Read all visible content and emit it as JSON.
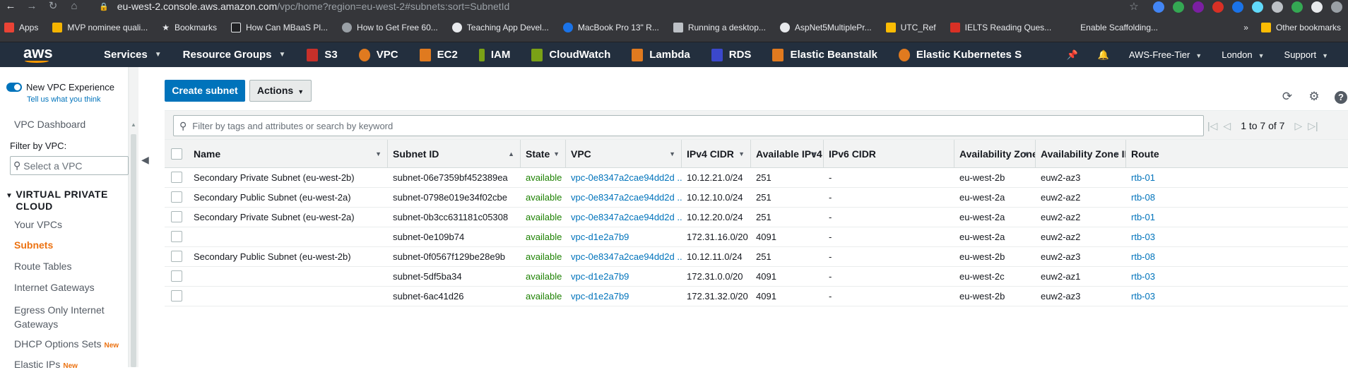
{
  "browser": {
    "url_prefix": "eu-west-2.console.aws.amazon.com",
    "url_path": "/vpc/home?region=eu-west-2#subnets:sort=SubnetId",
    "bookmarks": [
      {
        "label": "Apps",
        "color": "#ea4335"
      },
      {
        "label": "MVP nominee quali...",
        "color": "#f4b400"
      },
      {
        "label": "Bookmarks",
        "color": "#e8eaed"
      },
      {
        "label": "How Can MBaaS Pl...",
        "color": "#202124"
      },
      {
        "label": "How to Get Free 60...",
        "color": "#9aa0a6"
      },
      {
        "label": "Teaching App Devel...",
        "color": "#e8eaed"
      },
      {
        "label": "MacBook Pro 13\" R...",
        "color": "#1a73e8"
      },
      {
        "label": "Running a desktop...",
        "color": "#bdc1c6"
      },
      {
        "label": "AspNet5MultiplePr...",
        "color": "#e8eaed"
      },
      {
        "label": "UTC_Ref",
        "color": "#fbbc04"
      },
      {
        "label": "IELTS Reading Ques...",
        "color": "#d93025"
      },
      {
        "label": "Enable Scaffolding...",
        "color": "#35363a"
      }
    ],
    "other_bookmarks": "Other bookmarks",
    "more": "»"
  },
  "header": {
    "logo": "aws",
    "services": "Services",
    "resource_groups": "Resource Groups",
    "shortcuts": [
      {
        "label": "S3",
        "color": "#c7302a"
      },
      {
        "label": "VPC",
        "color": "#e07a1f"
      },
      {
        "label": "EC2",
        "color": "#e07a1f"
      },
      {
        "label": "IAM",
        "color": "#7aa116"
      },
      {
        "label": "CloudWatch",
        "color": "#7aa116"
      },
      {
        "label": "Lambda",
        "color": "#e07a1f"
      },
      {
        "label": "RDS",
        "color": "#3b48cc"
      },
      {
        "label": "Elastic Beanstalk",
        "color": "#e07a1f"
      },
      {
        "label": "Elastic Kubernetes S",
        "color": "#e07a1f"
      }
    ],
    "account": "AWS-Free-Tier",
    "region": "London",
    "support": "Support"
  },
  "sidebar": {
    "new_experience": "New VPC Experience",
    "tell_us": "Tell us what you think",
    "dashboard": "VPC Dashboard",
    "filter_label": "Filter by VPC:",
    "select_placeholder": "Select a VPC",
    "section": "VIRTUAL PRIVATE CLOUD",
    "items": [
      {
        "label": "Your VPCs",
        "active": false
      },
      {
        "label": "Subnets",
        "active": true
      },
      {
        "label": "Route Tables",
        "active": false
      },
      {
        "label": "Internet Gateways",
        "active": false
      },
      {
        "label": "Egress Only Internet Gateways",
        "active": false
      },
      {
        "label": "DHCP Options Sets",
        "active": false,
        "badge": "New"
      },
      {
        "label": "Elastic IPs",
        "active": false,
        "badge": "New"
      }
    ]
  },
  "toolbar": {
    "create": "Create subnet",
    "actions": "Actions"
  },
  "table": {
    "filter_placeholder": "Filter by tags and attributes or search by keyword",
    "pager": "1 to 7 of 7",
    "columns": [
      "Name",
      "Subnet ID",
      "State",
      "VPC",
      "IPv4 CIDR",
      "Available IPv4 .",
      "IPv6 CIDR",
      "Availability Zone",
      "Availability Zone ID",
      "Route"
    ],
    "rows": [
      {
        "name": "Secondary Private Subnet (eu-west-2b)",
        "subnet": "subnet-06e7359bf452389ea",
        "state": "available",
        "vpc": "vpc-0e8347a2cae94dd2d ...",
        "cidr": "10.12.21.0/24",
        "avail": "251",
        "ipv6": "-",
        "az": "eu-west-2b",
        "azid": "euw2-az3",
        "route": "rtb-01"
      },
      {
        "name": "Secondary Public Subnet (eu-west-2a)",
        "subnet": "subnet-0798e019e34f02cbe",
        "state": "available",
        "vpc": "vpc-0e8347a2cae94dd2d ...",
        "cidr": "10.12.10.0/24",
        "avail": "251",
        "ipv6": "-",
        "az": "eu-west-2a",
        "azid": "euw2-az2",
        "route": "rtb-08"
      },
      {
        "name": "Secondary Private Subnet (eu-west-2a)",
        "subnet": "subnet-0b3cc631181c05308",
        "state": "available",
        "vpc": "vpc-0e8347a2cae94dd2d ...",
        "cidr": "10.12.20.0/24",
        "avail": "251",
        "ipv6": "-",
        "az": "eu-west-2a",
        "azid": "euw2-az2",
        "route": "rtb-01"
      },
      {
        "name": "",
        "subnet": "subnet-0e109b74",
        "state": "available",
        "vpc": "vpc-d1e2a7b9",
        "cidr": "172.31.16.0/20",
        "avail": "4091",
        "ipv6": "-",
        "az": "eu-west-2a",
        "azid": "euw2-az2",
        "route": "rtb-03"
      },
      {
        "name": "Secondary Public Subnet (eu-west-2b)",
        "subnet": "subnet-0f0567f129be28e9b",
        "state": "available",
        "vpc": "vpc-0e8347a2cae94dd2d ...",
        "cidr": "10.12.11.0/24",
        "avail": "251",
        "ipv6": "-",
        "az": "eu-west-2b",
        "azid": "euw2-az3",
        "route": "rtb-08"
      },
      {
        "name": "",
        "subnet": "subnet-5df5ba34",
        "state": "available",
        "vpc": "vpc-d1e2a7b9",
        "cidr": "172.31.0.0/20",
        "avail": "4091",
        "ipv6": "-",
        "az": "eu-west-2c",
        "azid": "euw2-az1",
        "route": "rtb-03"
      },
      {
        "name": "",
        "subnet": "subnet-6ac41d26",
        "state": "available",
        "vpc": "vpc-d1e2a7b9",
        "cidr": "172.31.32.0/20",
        "avail": "4091",
        "ipv6": "-",
        "az": "eu-west-2b",
        "azid": "euw2-az3",
        "route": "rtb-03"
      }
    ]
  }
}
